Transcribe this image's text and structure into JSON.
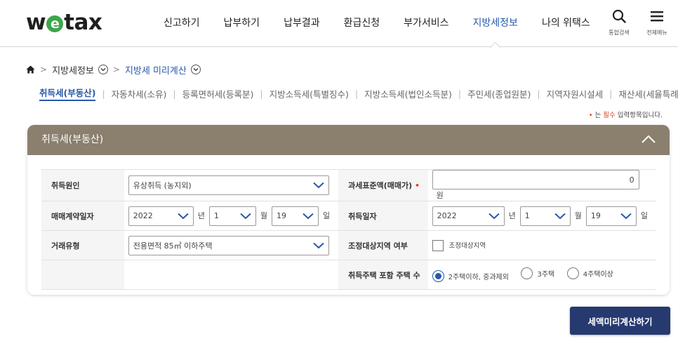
{
  "header": {
    "logo": {
      "pre": "w",
      "mid": "e",
      "post": "tax"
    },
    "nav": [
      "신고하기",
      "납부하기",
      "납부결과",
      "환급신청",
      "부가서비스",
      "지방세정보",
      "나의 위택스"
    ],
    "active_nav_index": 5,
    "search_label": "통합검색",
    "menu_label": "전체메뉴"
  },
  "breadcrumb": {
    "level1": "지방세정보",
    "level2": "지방세 미리계산"
  },
  "tabs": [
    "취득세(부동산)",
    "자동차세(소유)",
    "등록면허세(등록분)",
    "지방소득세(특별징수)",
    "지방소득세(법인소득분)",
    "주민세(종업원분)",
    "지역자원시설세",
    "재산세(세율특례)"
  ],
  "required_note": {
    "dot": "•",
    "pre": "는 ",
    "red": "필수",
    "post": " 입력항목입니다."
  },
  "panel": {
    "title": "취득세(부동산)",
    "fields": {
      "cause_label": "취득원인",
      "cause_value": "유상취득 (농지외)",
      "base_label": "과세표준액(매매가)",
      "required_dot": "•",
      "base_value": "0",
      "won": "원",
      "contract_label": "매매계약일자",
      "contract_year": "2022",
      "contract_month": "1",
      "contract_day": "19",
      "acq_label": "취득일자",
      "acq_year": "2022",
      "acq_month": "1",
      "acq_day": "19",
      "year_unit": "년",
      "month_unit": "월",
      "day_unit": "일",
      "deal_label": "거래유형",
      "deal_value": "전용면적 85㎡ 이하주택",
      "adjust_label": "조정대상지역 여부",
      "adjust_option": "조정대상지역",
      "houses_label": "취득주택 포함 주택 수",
      "houses_options": [
        "2주택이하, 중과제외",
        "3주택",
        "4주택이상"
      ],
      "houses_selected": 0
    }
  },
  "calc_button": "세액미리계산하기",
  "colors": {
    "accent": "#2859a8",
    "panel_head": "#8b7f6e",
    "button": "#263a6f",
    "logo_green": "#3da64a",
    "required": "#e0402b"
  }
}
